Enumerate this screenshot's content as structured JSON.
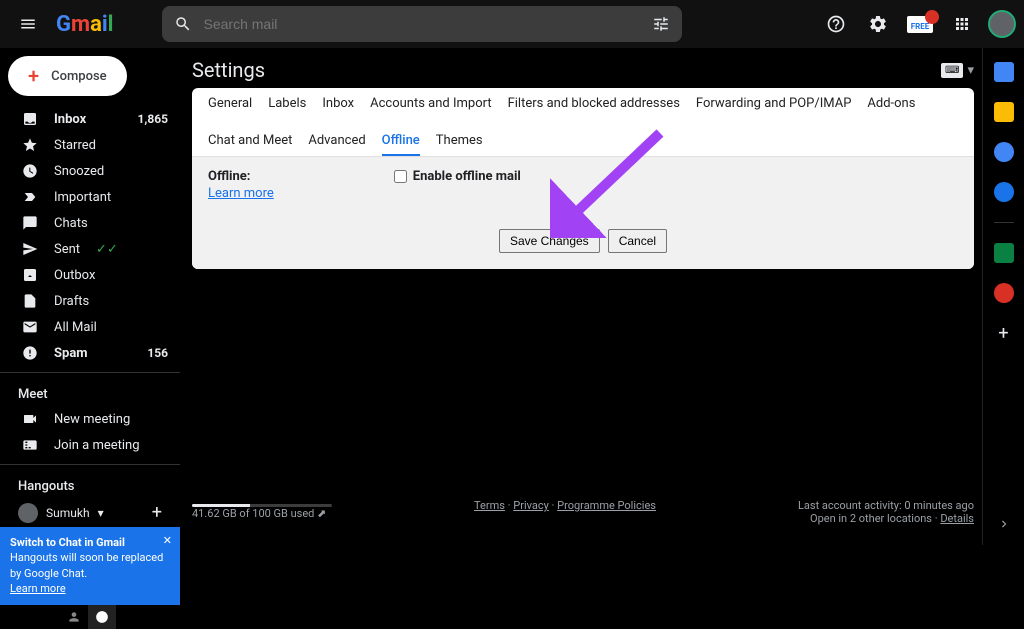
{
  "header": {
    "appName": "Gmail",
    "searchPlaceholder": "Search mail"
  },
  "compose": {
    "label": "Compose"
  },
  "nav": [
    {
      "icon": "inbox",
      "label": "Inbox",
      "count": "1,865",
      "bold": true
    },
    {
      "icon": "star",
      "label": "Starred"
    },
    {
      "icon": "clock",
      "label": "Snoozed"
    },
    {
      "icon": "important",
      "label": "Important"
    },
    {
      "icon": "chat",
      "label": "Chats"
    },
    {
      "icon": "send",
      "label": "Sent",
      "checks": true
    },
    {
      "icon": "outbox",
      "label": "Outbox"
    },
    {
      "icon": "file",
      "label": "Drafts"
    },
    {
      "icon": "mail",
      "label": "All Mail"
    },
    {
      "icon": "spam",
      "label": "Spam",
      "count": "156",
      "bold": true
    }
  ],
  "meet": {
    "head": "Meet",
    "items": [
      {
        "icon": "video",
        "label": "New meeting"
      },
      {
        "icon": "keyboard",
        "label": "Join a meeting"
      }
    ]
  },
  "hangouts": {
    "head": "Hangouts",
    "user": "Sumukh"
  },
  "banner": {
    "title": "Switch to Chat in Gmail",
    "body": "Hangouts will soon be replaced by Google Chat.",
    "learn": "Learn more"
  },
  "settings": {
    "title": "Settings",
    "tabs": [
      "General",
      "Labels",
      "Inbox",
      "Accounts and Import",
      "Filters and blocked addresses",
      "Forwarding and POP/IMAP",
      "Add-ons",
      "Chat and Meet",
      "Advanced",
      "Offline",
      "Themes"
    ],
    "activeTab": "Offline",
    "offline": {
      "label": "Offline:",
      "learn": "Learn more",
      "checkbox": "Enable offline mail"
    },
    "save": "Save Changes",
    "cancel": "Cancel"
  },
  "footer": {
    "storageText": "41.62 GB of 100 GB used",
    "storagePercent": 41.6,
    "terms": "Terms",
    "privacy": "Privacy",
    "policies": "Programme Policies",
    "activity": "Last account activity: 0 minutes ago",
    "locations": "Open in 2 other locations",
    "details": "Details"
  },
  "freeBadge": "FREE"
}
